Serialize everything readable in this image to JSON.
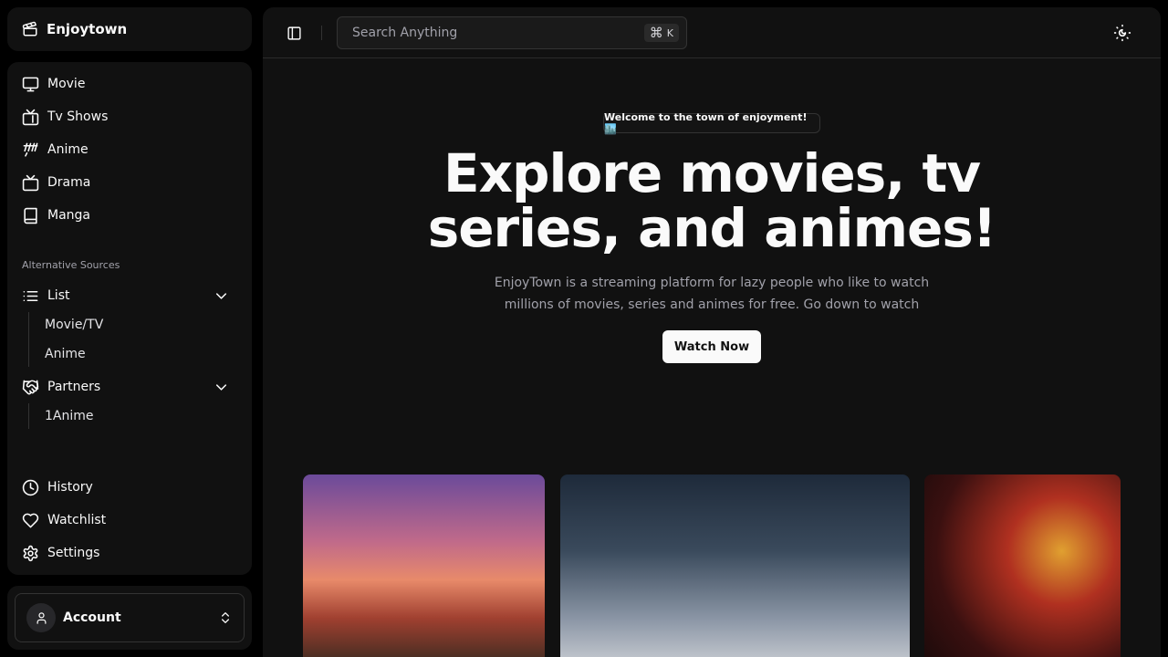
{
  "brand": {
    "name": "Enjoytown"
  },
  "sidebar": {
    "main_items": [
      {
        "label": "Movie",
        "icon": "monitor-icon"
      },
      {
        "label": "Tv Shows",
        "icon": "tv-icon"
      },
      {
        "label": "Anime",
        "icon": "anime-icon"
      },
      {
        "label": "Drama",
        "icon": "retro-tv-icon"
      },
      {
        "label": "Manga",
        "icon": "book-icon"
      }
    ],
    "section_label": "Alternative Sources",
    "list": {
      "label": "List",
      "children": [
        "Movie/TV",
        "Anime"
      ]
    },
    "partners": {
      "label": "Partners",
      "children": [
        "1Anime"
      ]
    },
    "bottom_items": [
      {
        "label": "History",
        "icon": "clock-icon"
      },
      {
        "label": "Watchlist",
        "icon": "heart-icon"
      },
      {
        "label": "Settings",
        "icon": "gear-icon"
      }
    ]
  },
  "account": {
    "label": "Account"
  },
  "topbar": {
    "search_placeholder": "Search Anything",
    "shortcut_key": "K",
    "shortcut_modifier": "⌘"
  },
  "hero": {
    "badge": "Welcome to the town of enjoyment! 🏙️",
    "title": "Explore movies, tv series, and animes!",
    "description": "EnjoyTown is a streaming platform for lazy people who like to watch millions of movies, series and animes for free. Go down to watch",
    "cta": "Watch Now"
  },
  "colors": {
    "background": "#000000",
    "panel": "#111111",
    "accent": "#fafafa",
    "muted": "#a1a1aa"
  }
}
